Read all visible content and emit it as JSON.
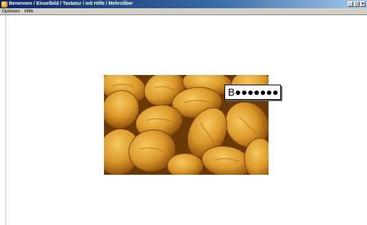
{
  "window": {
    "title": "Benennen / Einzelbild / Tastatur / mit Hilfe / Mehrsilber",
    "controls": {
      "minimize": "_",
      "maximize": "□",
      "close": "×"
    }
  },
  "menu": {
    "items": [
      {
        "label": "Optionen"
      },
      {
        "label": "Hilfe"
      }
    ]
  },
  "content": {
    "picture": {
      "icon": "bread-rolls-image"
    },
    "answer_field": {
      "value": "B●●●●●●●"
    }
  }
}
